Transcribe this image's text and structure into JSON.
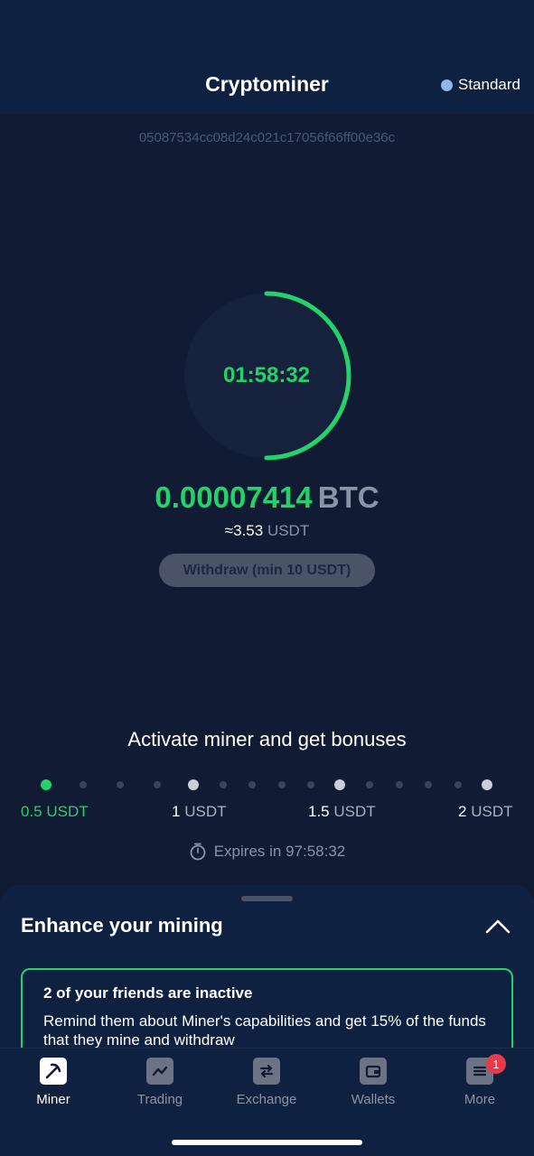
{
  "header": {
    "title": "Cryptominer",
    "plan_label": "Standard",
    "plan_color": "#8cb7e6"
  },
  "device_id": "05087534cc08d24c021c17056f66ff00e36c",
  "timer": {
    "value": "01:58:32",
    "ring_progress": 0.5,
    "color": "#22d36a"
  },
  "balance": {
    "amount": "0.00007414",
    "currency": "BTC",
    "approx_prefix": "≈3.53",
    "approx_unit": "USDT"
  },
  "withdraw_button": {
    "label": "Withdraw (min 10 USDT)"
  },
  "bonuses": {
    "title": "Activate miner and get bonuses",
    "milestones": [
      {
        "value": "0.5",
        "unit": "USDT",
        "active": true
      },
      {
        "value": "1",
        "unit": "USDT",
        "active": false
      },
      {
        "value": "1.5",
        "unit": "USDT",
        "active": false
      },
      {
        "value": "2",
        "unit": "USDT",
        "active": false
      }
    ],
    "expires_label": "Expires in 97:58:32"
  },
  "sheet": {
    "title": "Enhance your mining",
    "friends_card": {
      "title": "2 of your friends are inactive",
      "text": "Remind them about Miner's capabilities and get 15% of the funds that they mine and withdraw"
    }
  },
  "nav": {
    "items": [
      {
        "label": "Miner",
        "icon": "pickaxe-icon",
        "active": true
      },
      {
        "label": "Trading",
        "icon": "chart-icon",
        "active": false
      },
      {
        "label": "Exchange",
        "icon": "exchange-icon",
        "active": false
      },
      {
        "label": "Wallets",
        "icon": "wallet-icon",
        "active": false
      },
      {
        "label": "More",
        "icon": "menu-icon",
        "active": false,
        "badge": "1"
      }
    ]
  },
  "colors": {
    "accent_green": "#22d36a",
    "background": "#111b33",
    "surface": "#0f2140",
    "badge_red": "#e83a4a"
  }
}
